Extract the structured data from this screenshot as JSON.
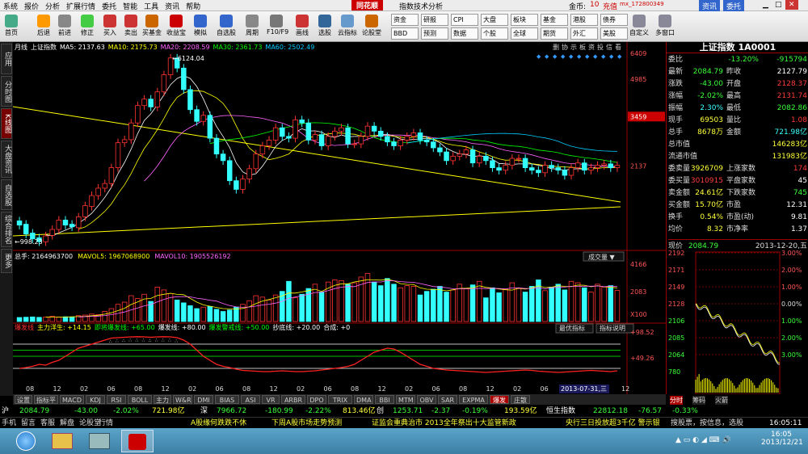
{
  "menu": [
    "系统",
    "报价",
    "分析",
    "扩展行情",
    "委托",
    "智能",
    "工具",
    "资讯",
    "帮助"
  ],
  "app_title": "同花顺",
  "app_subtitle": "指数技术分析",
  "account": {
    "label": "金币:",
    "coins": "10",
    "recharge": "充值",
    "user": "mx_172800349"
  },
  "window_buttons": {
    "news": "资讯",
    "trade": "委托"
  },
  "toolbar": [
    {
      "label": "首页",
      "icon": "home-icon"
    },
    {
      "label": "后退",
      "icon": "back-icon"
    },
    {
      "label": "前进",
      "icon": "forward-icon"
    },
    {
      "label": "修正",
      "icon": "refresh-icon"
    },
    {
      "label": "买入",
      "icon": "buy-icon"
    },
    {
      "label": "卖出",
      "icon": "sell-icon"
    },
    {
      "label": "买基金",
      "icon": "fund-icon"
    },
    {
      "label": "收益宝",
      "icon": "treasure-icon"
    },
    {
      "label": "模拟",
      "icon": "simulate-icon"
    },
    {
      "label": "自选股",
      "icon": "star-icon"
    },
    {
      "label": "周期",
      "icon": "period-icon"
    },
    {
      "label": "F10/F9",
      "icon": "f10-icon"
    },
    {
      "label": "画线",
      "icon": "drawline-icon"
    },
    {
      "label": "选股",
      "icon": "pick-icon"
    },
    {
      "label": "云指标",
      "icon": "cloud-icon"
    },
    {
      "label": "论股堂",
      "icon": "forum-icon"
    }
  ],
  "toolbar_right": [
    [
      "资金",
      "BBD"
    ],
    [
      "研报",
      "预测"
    ],
    [
      "CPI",
      "数据"
    ],
    [
      "大盘",
      "个股"
    ],
    [
      "板块",
      "全球"
    ],
    [
      "基金",
      "期货"
    ],
    [
      "港股",
      "外汇"
    ],
    [
      "债券",
      "美股"
    ]
  ],
  "toolbar_far": [
    "自定义",
    "多窗口"
  ],
  "side_tabs": [
    "应用",
    "分时图",
    "K线图",
    "大盘资讯",
    "自选股",
    "综合排名",
    "更多"
  ],
  "chart": {
    "period": "月线",
    "name": "上证指数",
    "ma_legend": [
      {
        "t": "MA5: 2137.63",
        "c": "#ffffff"
      },
      {
        "t": "MA10: 2175.73",
        "c": "#ffff00"
      },
      {
        "t": "MA20: 2208.59",
        "c": "#ff66ff"
      },
      {
        "t": "MA30: 2361.73",
        "c": "#00ff00"
      },
      {
        "t": "MA60: 2502.49",
        "c": "#00ccff"
      }
    ],
    "y_labels": [
      "6409",
      "4985",
      "3459",
      "2137"
    ],
    "max_label": "6124.04",
    "min_label": "998.23",
    "toolbar_icons": [
      "删",
      "协",
      "示",
      "板",
      "资",
      "投",
      "信",
      "看"
    ],
    "volume_legend": [
      {
        "t": "总手: 2164963700",
        "c": "#ffffff"
      },
      {
        "t": "MAVOL5: 1967068900",
        "c": "#ffff00"
      },
      {
        "t": "MAVOL10: 1905526192",
        "c": "#ff66ff"
      }
    ],
    "volume_y": [
      "4166",
      "2083",
      "X100"
    ],
    "volume_dropdown": "成交量",
    "ind_legend": [
      {
        "t": "爆发线",
        "c": "#ff3333"
      },
      {
        "t": "主力洋生: +14.15",
        "c": "#ffff00"
      },
      {
        "t": "即将爆发线: +65.00",
        "c": "#00ff00"
      },
      {
        "t": "爆发线: +80.00",
        "c": "#ffffff"
      },
      {
        "t": "爆发警戒线: +50.00",
        "c": "#00ff00"
      },
      {
        "t": "抄底线: +20.00",
        "c": "#ffffff"
      },
      {
        "t": "合成: +0",
        "c": "#ffffff"
      }
    ],
    "ind_y": [
      "+98.52",
      "+49.26"
    ],
    "ind_buttons": [
      "最优指标",
      "指标说明"
    ],
    "x_labels": [
      "08",
      "12",
      "02",
      "06",
      "08",
      "12",
      "02",
      "06",
      "08",
      "12",
      "02",
      "06",
      "08",
      "12",
      "02",
      "06",
      "08",
      "12",
      "02",
      "06",
      "12",
      "08",
      "12"
    ],
    "date_tag": "2013-07-31,三"
  },
  "chart_data": {
    "type": "candlestick",
    "title": "上证指数",
    "yscale": "log",
    "ylim": [
      998.23,
      6409
    ],
    "close": [
      1200,
      1100,
      1050,
      1020,
      1080,
      1150,
      1260,
      1200,
      1180,
      1300,
      1450,
      1600,
      1720,
      1800,
      2100,
      2680,
      2760,
      3250,
      3850,
      4100,
      3800,
      4400,
      5200,
      6124,
      5550,
      4500,
      3700,
      3300,
      3500,
      2800,
      2400,
      2250,
      1850,
      1700,
      1880,
      2080,
      2400,
      2600,
      2750,
      3100,
      2850,
      2800,
      3350,
      3250,
      2750,
      2900,
      2600,
      2850,
      3000,
      3100,
      2650,
      2650,
      2850,
      3150,
      3000,
      2850,
      2700,
      2600,
      2750,
      2850,
      2950,
      2750,
      2700,
      2550,
      2450,
      2250,
      2350,
      2400,
      2500,
      2200,
      2350,
      2250,
      2100,
      2050,
      2150,
      2300,
      2300,
      2100,
      2050,
      2000,
      2150,
      2100,
      2050,
      1950,
      2100,
      2200,
      2050,
      2100,
      2150,
      2180,
      2100,
      2150
    ],
    "open": [
      1250,
      1210,
      1110,
      1060,
      1020,
      1085,
      1150,
      1260,
      1210,
      1170,
      1300,
      1440,
      1600,
      1720,
      1800,
      2100,
      2680,
      2760,
      3250,
      3850,
      4100,
      3800,
      4400,
      5200,
      6124,
      5550,
      4500,
      3700,
      3300,
      3500,
      2800,
      2400,
      2250,
      1850,
      1700,
      1880,
      2080,
      2400,
      2600,
      2750,
      3100,
      2850,
      2800,
      3350,
      3250,
      2750,
      2900,
      2600,
      2850,
      3000,
      3100,
      2650,
      2650,
      2850,
      3150,
      3000,
      2850,
      2700,
      2600,
      2750,
      2850,
      2950,
      2750,
      2700,
      2550,
      2450,
      2250,
      2350,
      2400,
      2500,
      2200,
      2350,
      2250,
      2100,
      2050,
      2150,
      2300,
      2300,
      2100,
      2050,
      2000,
      2150,
      2100,
      2050,
      1950,
      2100,
      2200,
      2050,
      2100,
      2150,
      2180,
      2100
    ],
    "volume": [
      280,
      300,
      320,
      290,
      310,
      360,
      300,
      330,
      320,
      410,
      450,
      520,
      480,
      700,
      900,
      1200,
      1350,
      1800,
      1600,
      1900,
      1400,
      2400,
      2200,
      1950,
      1500,
      1300,
      1100,
      900,
      1000,
      1050,
      850,
      700,
      800,
      1000,
      1200,
      1450,
      1800,
      1700,
      1500,
      1850,
      2100,
      2800,
      1650,
      1900,
      2300,
      2600,
      2050,
      2750,
      2900,
      2850,
      2600,
      2700,
      3100,
      3350,
      2750,
      2500,
      3000,
      2600,
      2350,
      2500,
      2450,
      1850,
      2100,
      2250,
      2450,
      2050,
      2200,
      2600,
      2300,
      2550,
      2800,
      1650,
      2350,
      2000,
      2250,
      2700,
      2300,
      2050,
      2450,
      2900,
      2150,
      2400,
      2600,
      2200,
      2800,
      2700,
      2350,
      2050,
      2600,
      2400,
      2500,
      2164
    ],
    "indicator": [
      20,
      22,
      25,
      30,
      28,
      35,
      40,
      50,
      60,
      70,
      75,
      80,
      85,
      90,
      95,
      96,
      97,
      98,
      98.5,
      98,
      97,
      98,
      98.5,
      98,
      96,
      90,
      80,
      65,
      50,
      40,
      30,
      25,
      22,
      18,
      15,
      14,
      13,
      12,
      12,
      13,
      14,
      13,
      12,
      12,
      13,
      14,
      16,
      18,
      20,
      22,
      25,
      30,
      40,
      50,
      60,
      65,
      70,
      68,
      60,
      50,
      40,
      30,
      25,
      20,
      18,
      16,
      15,
      14,
      13,
      12,
      11,
      10,
      11,
      12,
      13,
      14,
      15,
      16,
      15,
      13,
      12,
      11,
      10,
      11,
      12,
      13,
      14,
      15,
      14,
      13,
      12,
      14
    ]
  },
  "quote": {
    "title": "上证指数 1A0001",
    "rows": [
      {
        "l": "委比",
        "v1": "-13.20%",
        "c1": "green",
        "v2": "-915794",
        "c2": "green"
      },
      {
        "l": "最新",
        "v1": "2084.79",
        "c1": "green",
        "l2": "昨收",
        "v2": "2127.79",
        "c2": "white"
      },
      {
        "l": "涨跌",
        "v1": "-43.00",
        "c1": "green",
        "l2": "开盘",
        "v2": "2128.37",
        "c2": "red"
      },
      {
        "l": "涨幅",
        "v1": "-2.02%",
        "c1": "green",
        "l2": "最高",
        "v2": "2131.74",
        "c2": "red"
      },
      {
        "l": "振幅",
        "v1": "2.30%",
        "c1": "cyan",
        "l2": "最低",
        "v2": "2082.86",
        "c2": "green"
      },
      {
        "l": "现手",
        "v1": "69503",
        "c1": "yellow",
        "l2": "量比",
        "v2": "1.08",
        "c2": "red"
      },
      {
        "l": "总手",
        "v1": "8678万",
        "c1": "yellow",
        "l2": "金额",
        "v2": "721.98亿",
        "c2": "cyan"
      },
      {
        "l": "总市值",
        "v1": "",
        "c1": "white",
        "v2": "146283亿",
        "c2": "yellow"
      },
      {
        "l": "流通市值",
        "v1": "",
        "c1": "white",
        "v2": "131983亿",
        "c2": "yellow"
      },
      {
        "l": "委卖量",
        "v1": "3926709",
        "c1": "yellow",
        "l2": "上涨家数",
        "v2": "174",
        "c2": "red"
      },
      {
        "l": "委买量",
        "v1": "3010915",
        "c1": "red",
        "l2": "平盘家数",
        "v2": "45",
        "c2": "white"
      },
      {
        "l": "卖金额",
        "v1": "24.61亿",
        "c1": "yellow",
        "l2": "下跌家数",
        "v2": "745",
        "c2": "green"
      },
      {
        "l": "买金额",
        "v1": "15.70亿",
        "c1": "yellow",
        "l2": "市盈",
        "v2": "12.31",
        "c2": "white"
      },
      {
        "l": "换手",
        "v1": "0.54%",
        "c1": "yellow",
        "l2": "市盈(动)",
        "v2": "9.81",
        "c2": "white"
      },
      {
        "l": "均价",
        "v1": "8.32",
        "c1": "yellow",
        "l2": "市净率",
        "v2": "1.37",
        "c2": "white"
      }
    ],
    "current_label": "现价",
    "current_value": "2084.79",
    "current_date": "2013-12-20,五",
    "mini_left": [
      "2192",
      "2171",
      "2149",
      "2128",
      "2106",
      "2085",
      "2064",
      "780"
    ],
    "mini_right": [
      "3.00%",
      "2.00%",
      "1.00%",
      "0.00%",
      "1.00%",
      "2.00%",
      "3.00%"
    ],
    "mini_tabs": [
      "分时",
      "筹码",
      "火箭"
    ]
  },
  "bottom_tabs": [
    "设置",
    "指标平台",
    "MACD",
    "KDJ",
    "RSI",
    "BOLL",
    "主力",
    "W&R",
    "DMI",
    "BIAS",
    "ASI",
    "VR",
    "ARBR",
    "DPO",
    "TRIX",
    "DMA",
    "BBI",
    "MTM",
    "OBV",
    "SAR",
    "EXPMA",
    "爆发线",
    "庄散线"
  ],
  "ticker1": [
    {
      "t": "沪",
      "c": "#fff"
    },
    {
      "t": "2084.79",
      "c": "#3cff3c"
    },
    {
      "t": "-43.00",
      "c": "#3cff3c"
    },
    {
      "t": "-2.02%",
      "c": "#3cff3c"
    },
    {
      "t": "721.98亿",
      "c": "#ffff3c"
    },
    {
      "t": "深",
      "c": "#fff"
    },
    {
      "t": "7966.72",
      "c": "#3cff3c"
    },
    {
      "t": "-180.99",
      "c": "#3cff3c"
    },
    {
      "t": "-2.22%",
      "c": "#3cff3c"
    },
    {
      "t": "813.46亿",
      "c": "#ffff3c"
    },
    {
      "t": "创",
      "c": "#fff"
    },
    {
      "t": "1253.71",
      "c": "#3cff3c"
    },
    {
      "t": "-2.37",
      "c": "#3cff3c"
    },
    {
      "t": "-0.19%",
      "c": "#3cff3c"
    },
    {
      "t": "193.59亿",
      "c": "#ffff3c"
    },
    {
      "t": "恒生指数",
      "c": "#fff"
    },
    {
      "t": "22812.18",
      "c": "#3cff3c"
    },
    {
      "t": "-76.57",
      "c": "#3cff3c"
    },
    {
      "t": "-0.33%",
      "c": "#3cff3c"
    }
  ],
  "ticker2": {
    "items": [
      "手机",
      "留言",
      "客服",
      "解盘",
      "论股堂",
      "行情"
    ],
    "news": [
      "A股缘何跌跌不休",
      "下周A股市场走势预测",
      "证监会重典治市 2013全年祭出十大监管新政",
      "央行三日投放超3千亿 警示银"
    ],
    "right": "搜股票，按信息，选股",
    "time": "16:05:11"
  },
  "taskbar": {
    "time": "16:05",
    "date": "2013/12/21"
  }
}
